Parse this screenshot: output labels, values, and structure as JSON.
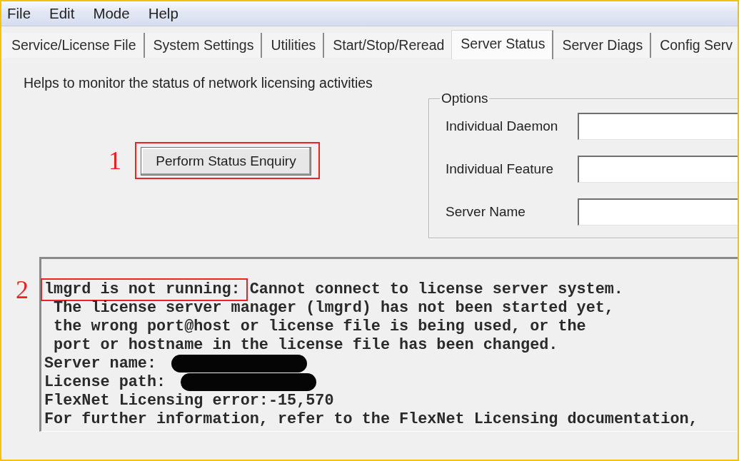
{
  "menu": [
    "File",
    "Edit",
    "Mode",
    "Help"
  ],
  "tabs": [
    {
      "label": "Service/License File",
      "selected": false
    },
    {
      "label": "System Settings",
      "selected": false
    },
    {
      "label": "Utilities",
      "selected": false
    },
    {
      "label": "Start/Stop/Reread",
      "selected": false
    },
    {
      "label": "Server Status",
      "selected": true
    },
    {
      "label": "Server Diags",
      "selected": false
    },
    {
      "label": "Config Serv",
      "selected": false
    }
  ],
  "description": "Helps to monitor the status of network licensing activities",
  "status_button": {
    "label": "Perform Status Enquiry",
    "callout": "1"
  },
  "options": {
    "title": "Options",
    "fields": [
      {
        "label": "Individual Daemon"
      },
      {
        "label": "Individual Feature"
      },
      {
        "label": "Server Name"
      }
    ]
  },
  "output": {
    "lines": [
      {
        "marked_text": "lmgrd is not running:",
        "callout": "2",
        "text": "Cannot connect to license server system.",
        "redacted": false
      },
      {
        "text": " The license server manager (lmgrd) has not been started yet,",
        "redacted": false
      },
      {
        "text": " the wrong port@host or license file is being used, or the",
        "redacted": false
      },
      {
        "text": " port or hostname in the license file has been changed.",
        "redacted": false
      },
      {
        "text": "Server name:",
        "redacted": true
      },
      {
        "text": "License path:",
        "redacted": true
      },
      {
        "text": "FlexNet Licensing error:-15,570",
        "redacted": false
      },
      {
        "text": "For further information, refer to the FlexNet Licensing documentation,",
        "redacted": false
      }
    ]
  }
}
